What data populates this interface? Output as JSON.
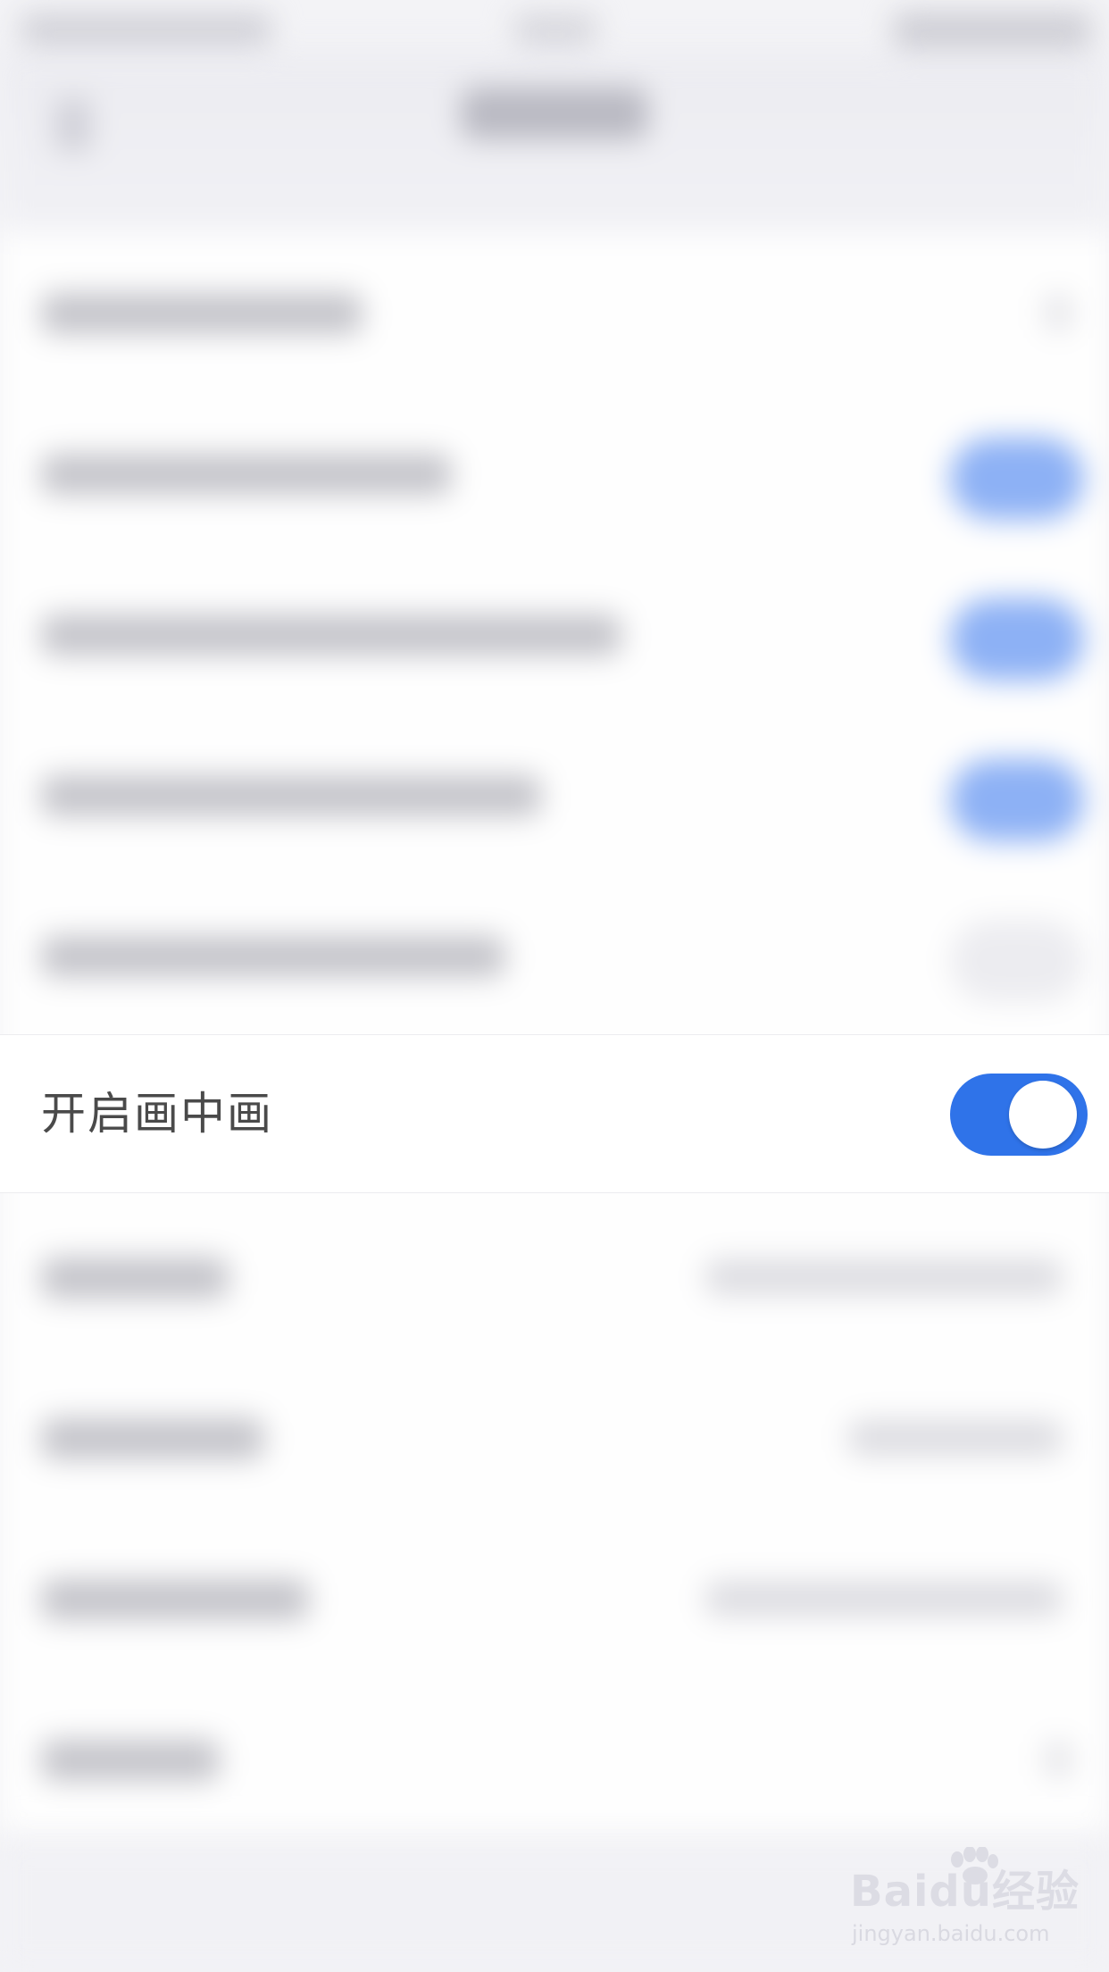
{
  "setting": {
    "label": "开启画中画",
    "enabled": true,
    "accent_color": "#2f73e9"
  },
  "watermark": {
    "brand": "Baidu经验",
    "url": "jingyan.baidu.com"
  }
}
